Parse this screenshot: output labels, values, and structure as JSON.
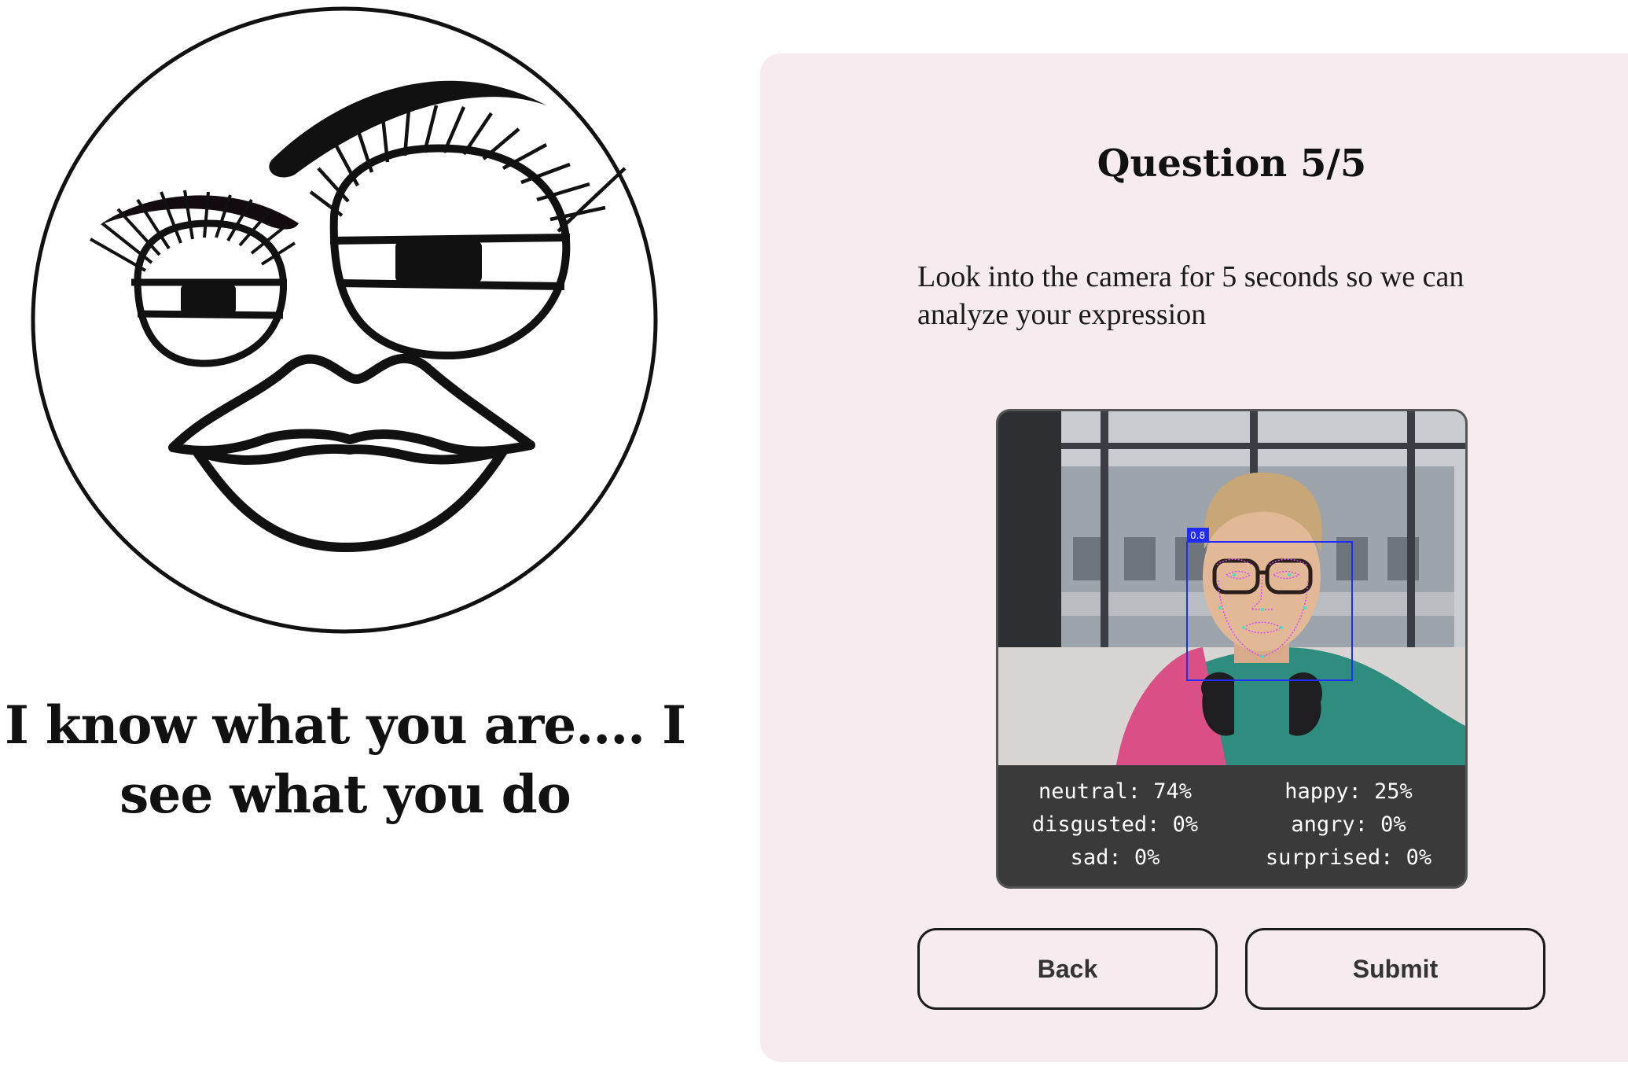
{
  "left_panel": {
    "tagline": "I know what you are.... I see what you do"
  },
  "quiz": {
    "title": "Question 5/5",
    "prompt": "Look into the camera for 5 seconds so we can analyze your expression",
    "camera": {
      "detection_score": "0.8",
      "emotions": [
        {
          "label": "neutral: 74%"
        },
        {
          "label": "happy: 25%"
        },
        {
          "label": "disgusted: 0%"
        },
        {
          "label": "angry: 0%"
        },
        {
          "label": "sad: 0%"
        },
        {
          "label": "surprised: 0%"
        }
      ]
    },
    "buttons": {
      "back_label": "Back",
      "submit_label": "Submit"
    }
  },
  "colors": {
    "card_background": "#f6ebef",
    "detection_box": "#1f2bff",
    "landmarks": "#d24bff",
    "widget_background": "#3a3a3a"
  }
}
